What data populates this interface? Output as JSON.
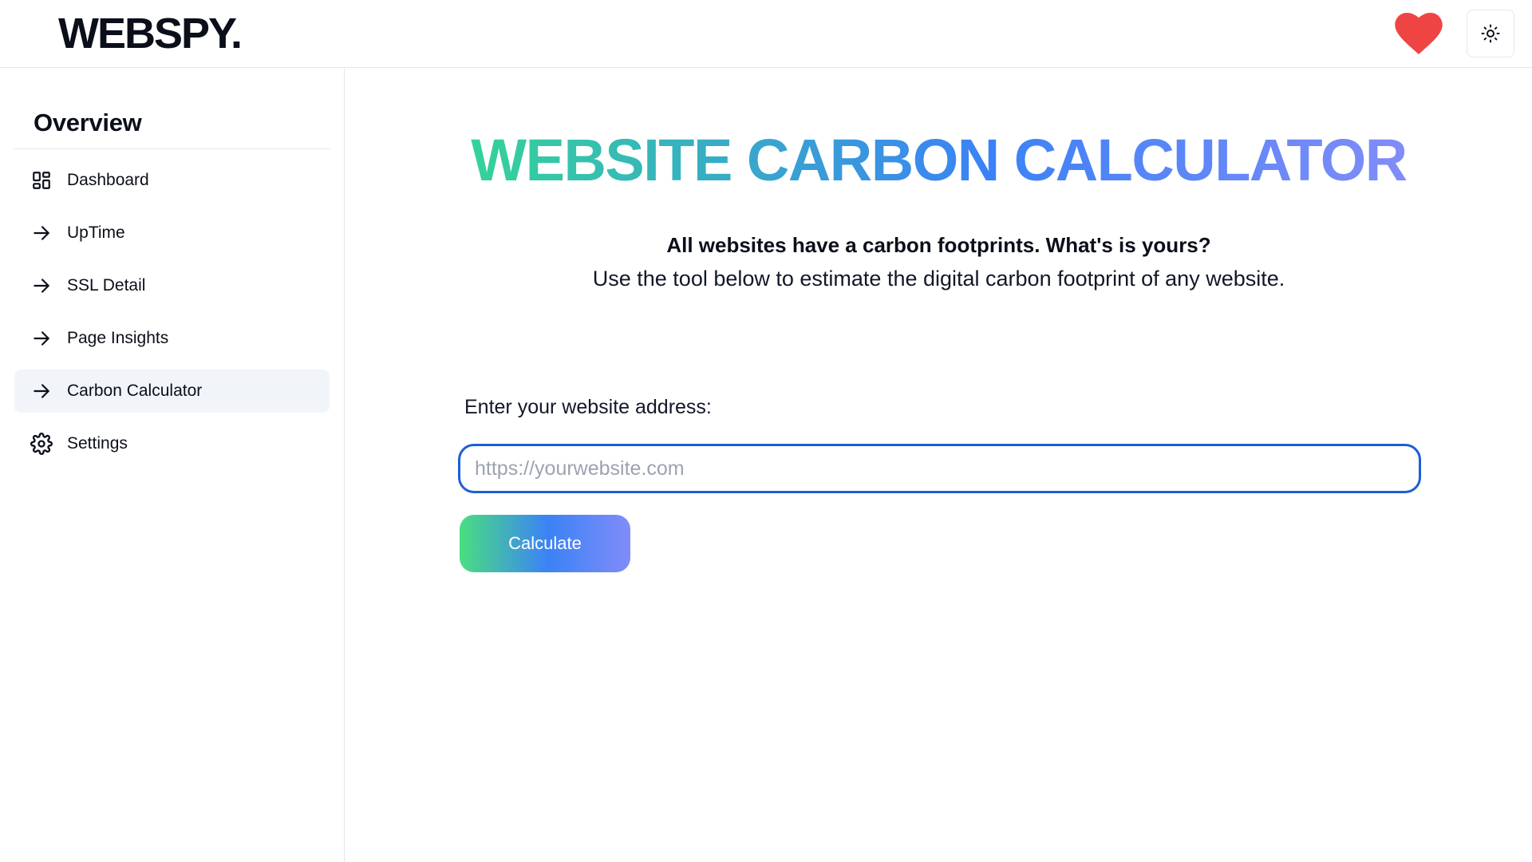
{
  "header": {
    "logo": "WEBSPY.",
    "heart_icon": "heart-icon",
    "theme_icon": "sun-icon",
    "heart_color": "#ef4444"
  },
  "sidebar": {
    "title": "Overview",
    "items": [
      {
        "label": "Dashboard",
        "icon": "dashboard-grid-icon",
        "active": false
      },
      {
        "label": "UpTime",
        "icon": "arrow-right-icon",
        "active": false
      },
      {
        "label": "SSL Detail",
        "icon": "arrow-right-icon",
        "active": false
      },
      {
        "label": "Page Insights",
        "icon": "arrow-right-icon",
        "active": false
      },
      {
        "label": "Carbon Calculator",
        "icon": "arrow-right-icon",
        "active": true
      },
      {
        "label": "Settings",
        "icon": "gear-icon",
        "active": false
      }
    ]
  },
  "main": {
    "headline": "WEBSITE CARBON CALCULATOR",
    "tagline": "All websites have a carbon footprints. What's is yours?",
    "subtext": "Use the tool below to estimate the digital carbon footprint of any website.",
    "field_label": "Enter your website address:",
    "input_value": "",
    "input_placeholder": "https://yourwebsite.com",
    "button_label": "Calculate"
  },
  "colors": {
    "gradient_start": "#34d399",
    "gradient_mid": "#3b82f6",
    "gradient_end": "#818cf8",
    "input_border": "#1d5fd6",
    "active_nav_bg": "#f1f5f9"
  }
}
